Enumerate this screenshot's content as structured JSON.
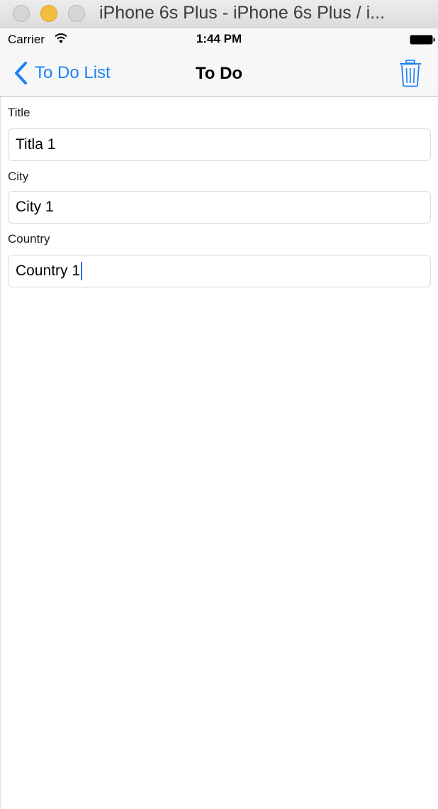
{
  "window": {
    "title": "iPhone 6s Plus - iPhone 6s Plus / i..."
  },
  "status_bar": {
    "carrier": "Carrier",
    "time": "1:44 PM"
  },
  "nav_bar": {
    "back_label": "To Do List",
    "title": "To Do",
    "accent_color": "#1a82f7"
  },
  "form": {
    "fields": [
      {
        "label": "Title",
        "value": "Titla 1"
      },
      {
        "label": "City",
        "value": "City 1"
      },
      {
        "label": "Country",
        "value": "Country 1"
      }
    ]
  },
  "icons": {
    "back": "chevron-left-icon",
    "delete": "trash-icon",
    "wifi": "wifi-icon",
    "battery": "battery-icon"
  }
}
